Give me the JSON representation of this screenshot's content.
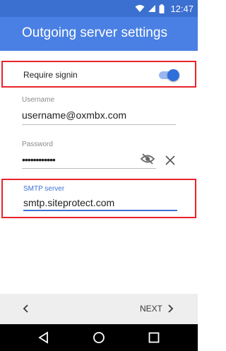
{
  "status_bar": {
    "time": "12:47",
    "icons": [
      "wifi-icon",
      "signal-icon",
      "battery-icon"
    ]
  },
  "app_bar": {
    "title": "Outgoing server settings"
  },
  "require_signin": {
    "label": "Require signin",
    "enabled": true
  },
  "username": {
    "label": "Username",
    "value": "username@oxmbx.com"
  },
  "password": {
    "label": "Password",
    "value": "••••••••••••",
    "icons": [
      "visibility-off-icon",
      "clear-icon"
    ]
  },
  "smtp": {
    "label": "SMTP server",
    "value": "smtp.siteprotect.com"
  },
  "bottom": {
    "next_label": "NEXT"
  },
  "nav": {
    "icons": [
      "back-triangle-icon",
      "home-circle-icon",
      "recents-square-icon"
    ]
  },
  "colors": {
    "status_bar": "#3b6fd0",
    "app_bar": "#4a80e3",
    "accent": "#3d72d6",
    "highlight": "#e8242b"
  }
}
